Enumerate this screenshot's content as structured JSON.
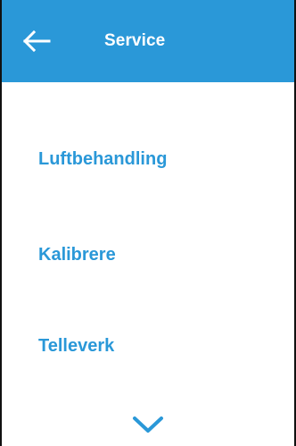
{
  "header": {
    "title": "Service",
    "back_icon": "arrow-left-icon"
  },
  "menu": {
    "items": [
      {
        "label": "Luftbehandling"
      },
      {
        "label": "Kalibrere"
      },
      {
        "label": "Telleverk"
      }
    ],
    "more_icon": "chevron-down-icon"
  },
  "colors": {
    "accent": "#2a98d8",
    "header_text": "#ffffff",
    "background": "#ffffff",
    "frame": "#111111"
  }
}
